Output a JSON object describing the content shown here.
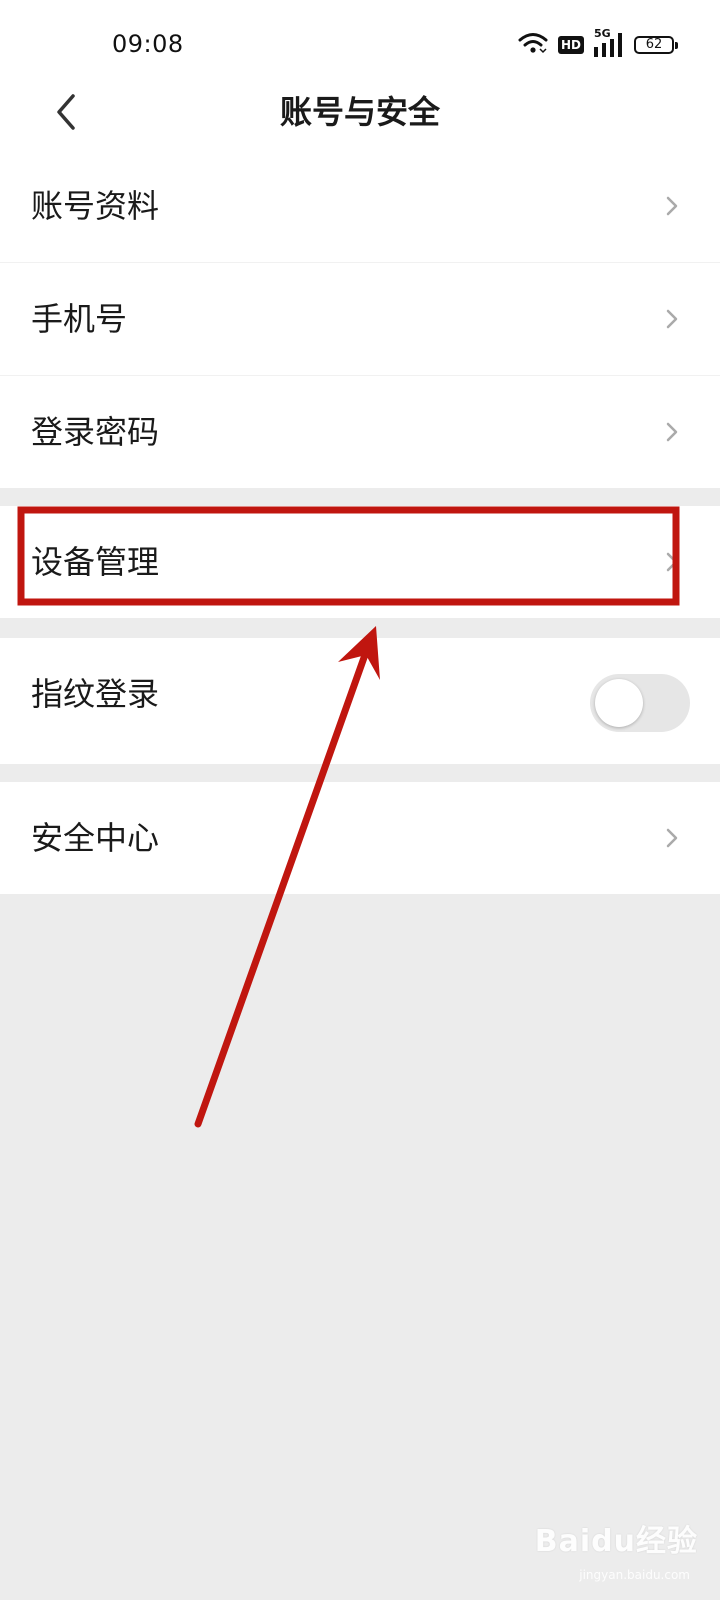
{
  "status_bar": {
    "time": "09:08",
    "hd_label": "HD",
    "network_label": "5G",
    "battery": "62"
  },
  "header": {
    "title": "账号与安全"
  },
  "settings": {
    "account_profile": "账号资料",
    "phone_number": "手机号",
    "login_password": "登录密码",
    "device_management": "设备管理",
    "fingerprint_login": "指纹登录",
    "security_center": "安全中心"
  },
  "fingerprint_toggle_on": false,
  "watermark": {
    "brand": "Baidu经验",
    "url": "jingyan.baidu.com"
  },
  "annotation_color": "#c0160f"
}
